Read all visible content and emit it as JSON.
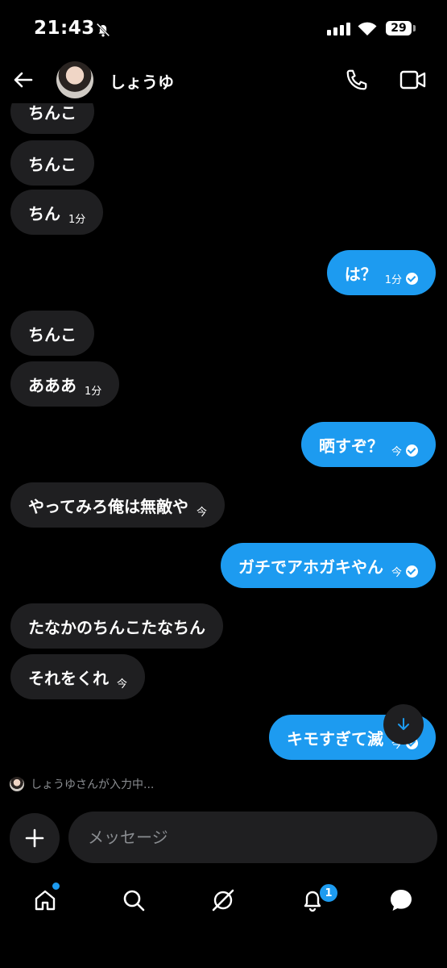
{
  "status_bar": {
    "time": "21:43",
    "battery": "29"
  },
  "header": {
    "contact_name": "しょうゆ"
  },
  "messages": [
    {
      "side": "in",
      "text": "ちんこ",
      "time": ""
    },
    {
      "side": "in",
      "text": "ちんこ",
      "time": ""
    },
    {
      "side": "in",
      "text": "ちん",
      "time": "1分"
    },
    {
      "side": "out",
      "text": "は？",
      "time": "1分"
    },
    {
      "side": "in",
      "text": "ちんこ",
      "time": ""
    },
    {
      "side": "in",
      "text": "あああ",
      "time": "1分"
    },
    {
      "side": "out",
      "text": "晒すぞ？",
      "time": "今"
    },
    {
      "side": "in",
      "text": "やってみろ俺は無敵や",
      "time": "今"
    },
    {
      "side": "out",
      "text": "ガチでアホガキやん",
      "time": "今"
    },
    {
      "side": "in",
      "text": "たなかのちんこたなちん",
      "time": ""
    },
    {
      "side": "in",
      "text": "それをくれ",
      "time": "今"
    },
    {
      "side": "out",
      "text": "キモすぎて滅",
      "time": "今"
    }
  ],
  "typing_indicator": "しょうゆさんが入力中...",
  "composer": {
    "placeholder": "メッセージ",
    "value": ""
  },
  "tabbar": {
    "items": [
      "home-icon",
      "search-icon",
      "grok-icon",
      "notifications-icon",
      "messages-icon"
    ],
    "notification_count": "1"
  },
  "colors": {
    "accent": "#1d9bf0",
    "bubble_in": "#1f1f21",
    "background": "#000000"
  }
}
